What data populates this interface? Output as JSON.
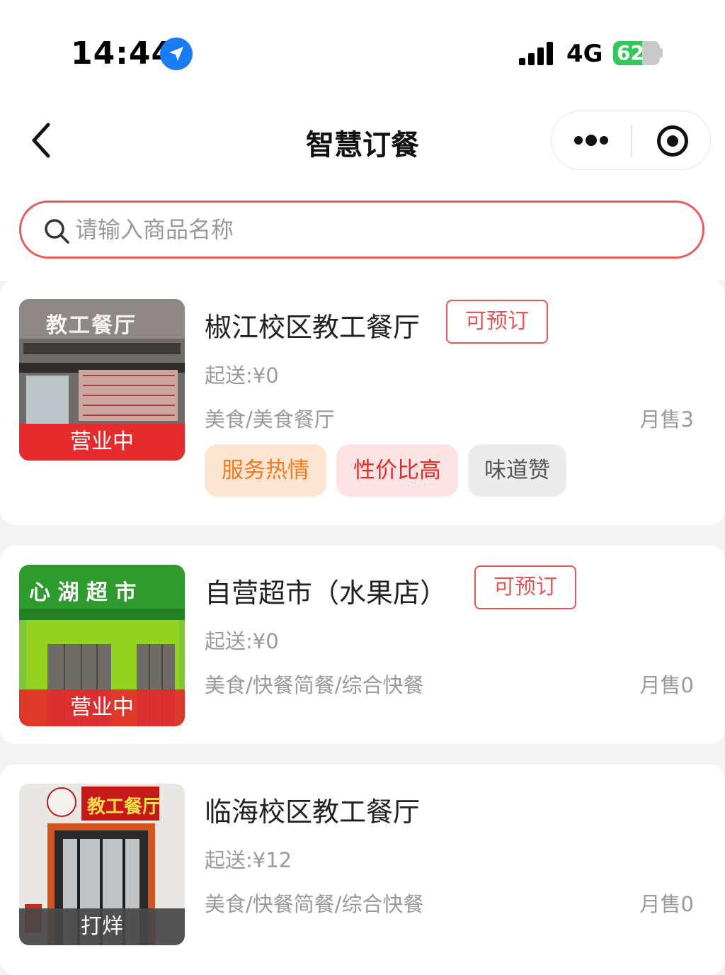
{
  "status_bar": {
    "time": "14:44",
    "network": "4G",
    "battery": "62",
    "battery_level": 0.62
  },
  "nav": {
    "title": "智慧订餐"
  },
  "search": {
    "placeholder": "请输入商品名称"
  },
  "colors": {
    "accent": "#e35656",
    "status_open": "#e52b2b",
    "status_closed": "#555555",
    "tag_orange_bg": "#fde5d2",
    "tag_orange_text": "#f07b20",
    "tag_red_bg": "#fde3e3",
    "tag_red_text": "#e42b2b",
    "tag_gray_bg": "#ececec",
    "tag_gray_text": "#555555"
  },
  "stores": [
    {
      "name": "椒江校区教工餐厅",
      "reserve": "可预订",
      "min_order": "起送:¥0",
      "category": "美食/美食餐厅",
      "monthly_sales": "月售3",
      "status": "营业中",
      "sign_text": "教工餐厅",
      "tags": [
        {
          "label": "服务热情",
          "style": "orange"
        },
        {
          "label": "性价比高",
          "style": "red"
        },
        {
          "label": "味道赞",
          "style": "gray"
        }
      ]
    },
    {
      "name": "自营超市（水果店）",
      "reserve": "可预订",
      "min_order": "起送:¥0",
      "category": "美食/快餐简餐/综合快餐",
      "monthly_sales": "月售0",
      "status": "营业中",
      "sign_text": "心 湖 超 市"
    },
    {
      "name": "临海校区教工餐厅",
      "min_order": "起送:¥12",
      "category": "美食/快餐简餐/综合快餐",
      "monthly_sales": "月售0",
      "status": "打烊",
      "sign_text": "教工餐厅"
    }
  ]
}
